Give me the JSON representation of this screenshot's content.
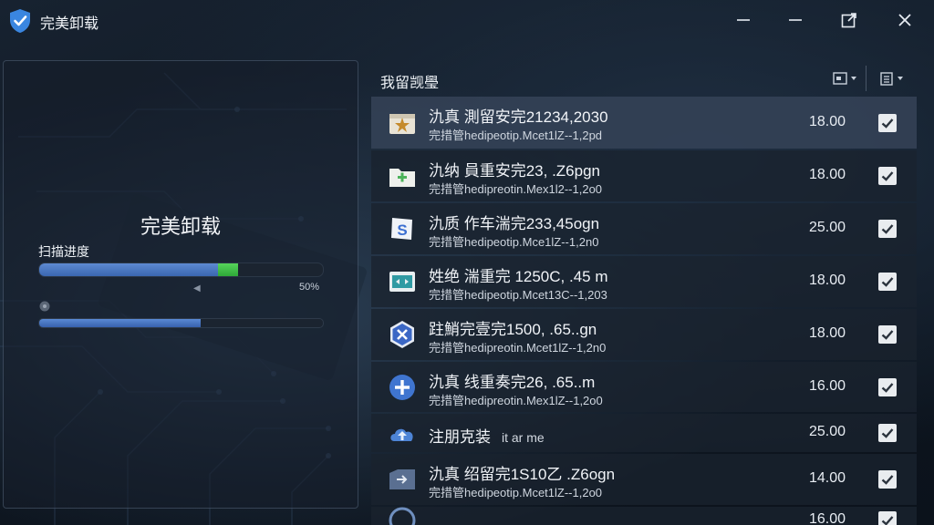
{
  "window": {
    "title": "完美卸载",
    "accent": "#3a78d8"
  },
  "scan_panel": {
    "title": "完美卸载",
    "progress_label": "扫描进度",
    "primary_progress": 0.7,
    "primary_progress_text": "50%",
    "secondary_progress": 0.57,
    "colors": {
      "progress": "#4a79c4",
      "highlight": "#3ec645"
    }
  },
  "list_panel": {
    "title": "我留觊璺",
    "items": [
      {
        "name": "氿真 測留安完21234,2030",
        "path": "完措管hedipeotip.Mcet1lZ--1,2pd",
        "size": "18.00",
        "checked": true,
        "icon": "star-package-icon",
        "icon_color": "#e9e3d5"
      },
      {
        "name": "氿纳 員重安完23, .Z6pgn",
        "path": "完措管hedipreotin.Mex1l2--1,2o0",
        "size": "18.00",
        "checked": true,
        "icon": "green-plus-folder-icon",
        "icon_color": "#4cb35a"
      },
      {
        "name": "氿质 作车湍完233,45ogn",
        "path": "完措管hedipeotip.Mce1lZ--1,2n0",
        "size": "25.00",
        "checked": true,
        "icon": "s-logo-icon",
        "icon_color": "#3c6fd1"
      },
      {
        "name": "姓绝 湍重完 1250C, .45 m",
        "path": "完措管hedipeotip.Mcet13C--1,203",
        "size": "18.00",
        "checked": true,
        "icon": "teal-arrows-icon",
        "icon_color": "#2f9aa3"
      },
      {
        "name": "跓鮹完壹完1500, .65..gn",
        "path": "完措管hedipreotin.Mcet1lZ--1,2n0",
        "size": "18.00",
        "checked": true,
        "icon": "x-hexagon-icon",
        "icon_color": "#3b67c5"
      },
      {
        "name": "氿真 线重奏完26, .65..m",
        "path": "完措管hedipreotin.Mex1lZ--1,2o0",
        "size": "16.00",
        "checked": true,
        "icon": "blue-plus-circle-icon",
        "icon_color": "#3f75d0"
      },
      {
        "name": "注朋克装",
        "extra": "it ar me",
        "size": "25.00",
        "checked": true,
        "icon": "cloud-upload-icon",
        "icon_color": "#4d84d6"
      },
      {
        "name": "氿真 绍留完1S10乙 .Z6ogn",
        "path": "完措管hedipeotip.Mcet1lZ--1,2o0",
        "size": "14.00",
        "checked": true,
        "icon": "arrow-box-icon",
        "icon_color": "#5a6f91"
      },
      {
        "name": "",
        "path": "",
        "size": "16.00",
        "checked": true,
        "icon": "partial-circle-icon",
        "icon_color": "#6f8fbf"
      }
    ]
  }
}
